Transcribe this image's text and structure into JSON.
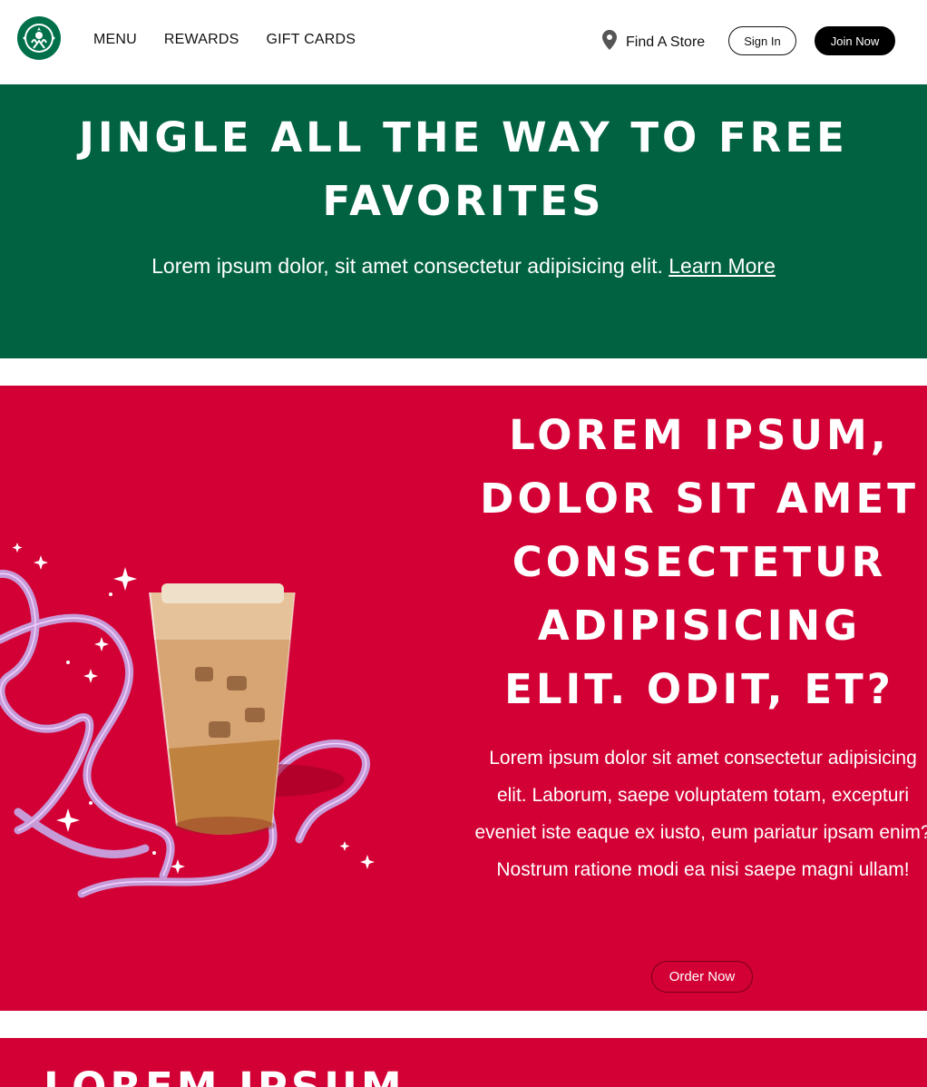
{
  "header": {
    "logo_icon": "starbucks-siren-logo",
    "nav": [
      {
        "label": "MENU"
      },
      {
        "label": "REWARDS"
      },
      {
        "label": "GIFT CARDS"
      }
    ],
    "find_store": {
      "icon": "location-pin-icon",
      "label": "Find A Store"
    },
    "sign_in_label": "Sign In",
    "join_label": "Join Now"
  },
  "promo": {
    "title": "JINGLE ALL THE WAY TO FREE FAVORITES",
    "text": "Lorem ipsum dolor, sit amet consectetur adipisicing elit.",
    "link_label": "Learn More"
  },
  "feature": {
    "title": "LOREM IPSUM, DOLOR SIT AMET CONSECTETUR ADIPISICING ELIT. ODIT, ET?",
    "text": "Lorem ipsum dolor sit amet consectetur adipisicing elit. Laborum, saepe voluptatem totam, excepturi eveniet iste eaque ex iusto, eum pariatur ipsam enim? Nostrum ratione modi ea nisi saepe magni ullam!",
    "button_label": "Order Now",
    "image": "iced-latte-with-ribbons-image"
  },
  "next_section": {
    "title": "LOREM IPSUM"
  },
  "colors": {
    "green": "#006241",
    "red": "#d20034",
    "ribbon": "#c79ad8",
    "black": "#000000"
  }
}
